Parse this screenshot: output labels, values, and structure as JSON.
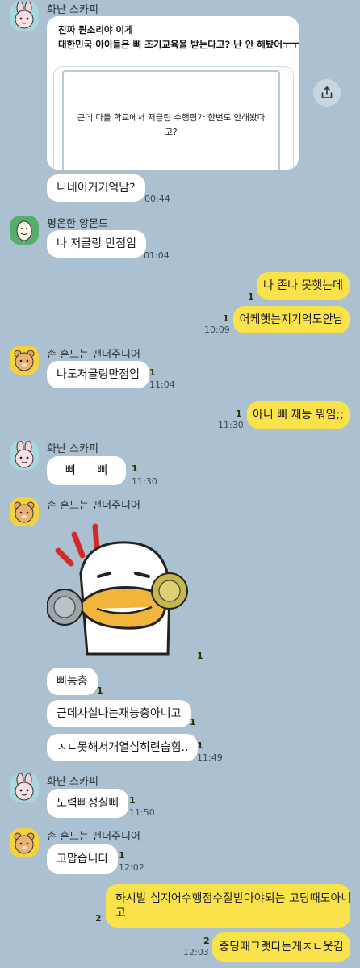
{
  "messages": {
    "m1": {
      "sender": "화난 스카피",
      "line1": "진짜 뭔소리야 이게",
      "line2": "대한민국 아이들은 삐 조기교육을 받는다고? 난 안 해봤어ㅜㅜ;",
      "preview": "근데 다들 학교에서 저글링 수행평가 한번도 안해봤다\n고?"
    },
    "m2": {
      "text": "니네이거기억남?",
      "time": "00:44"
    },
    "m3": {
      "sender": "평온한 앙몬드",
      "text": "나 저글링 만점임",
      "time": "01:04"
    },
    "m4": {
      "text": "나 존나 못햇는데",
      "unread": "1"
    },
    "m5": {
      "text": "어케햇는지기억도안남",
      "unread": "1",
      "time": "10:09"
    },
    "m6": {
      "sender": "손 흔드는 팬더주니어",
      "text": "나도저글링만점임",
      "unread": "1",
      "time": "11:04"
    },
    "m7": {
      "text": "아니 삐 재능 뭐임;;",
      "unread": "1",
      "time": "11:30"
    },
    "m8": {
      "sender": "화난 스카피",
      "text": "삐      삐",
      "unread": "1",
      "time": "11:30"
    },
    "m9": {
      "sender": "손 흔드는 팬더주니어",
      "unread": "1"
    },
    "m10": {
      "text": "삐능충",
      "unread": "1"
    },
    "m11": {
      "text": "근데사실나는재능충아니고",
      "unread": "1"
    },
    "m12": {
      "text": "ㅈㄴ못해서개열심히련습힘..",
      "unread": "1",
      "time": "11:49"
    },
    "m13": {
      "sender": "화난 스카피",
      "text": "노력삐성실삐",
      "unread": "1",
      "time": "11:50"
    },
    "m14": {
      "sender": "손 흔드는 팬더주니어",
      "text": "고맙습니다",
      "unread": "1",
      "time": "12:02"
    },
    "m15": {
      "line1": "하시발 심지어수행점수잘받아야되는 고딩때도아니",
      "line2": "고",
      "unread": "2"
    },
    "m16": {
      "text": "중딩때그랫다는게ㅈㄴ웃김",
      "unread": "2",
      "time": "12:03"
    }
  },
  "icons": {
    "share": "share-icon"
  },
  "colors": {
    "background": "#abc1d1",
    "outgoing": "#fae34a",
    "incoming": "#ffffff"
  }
}
